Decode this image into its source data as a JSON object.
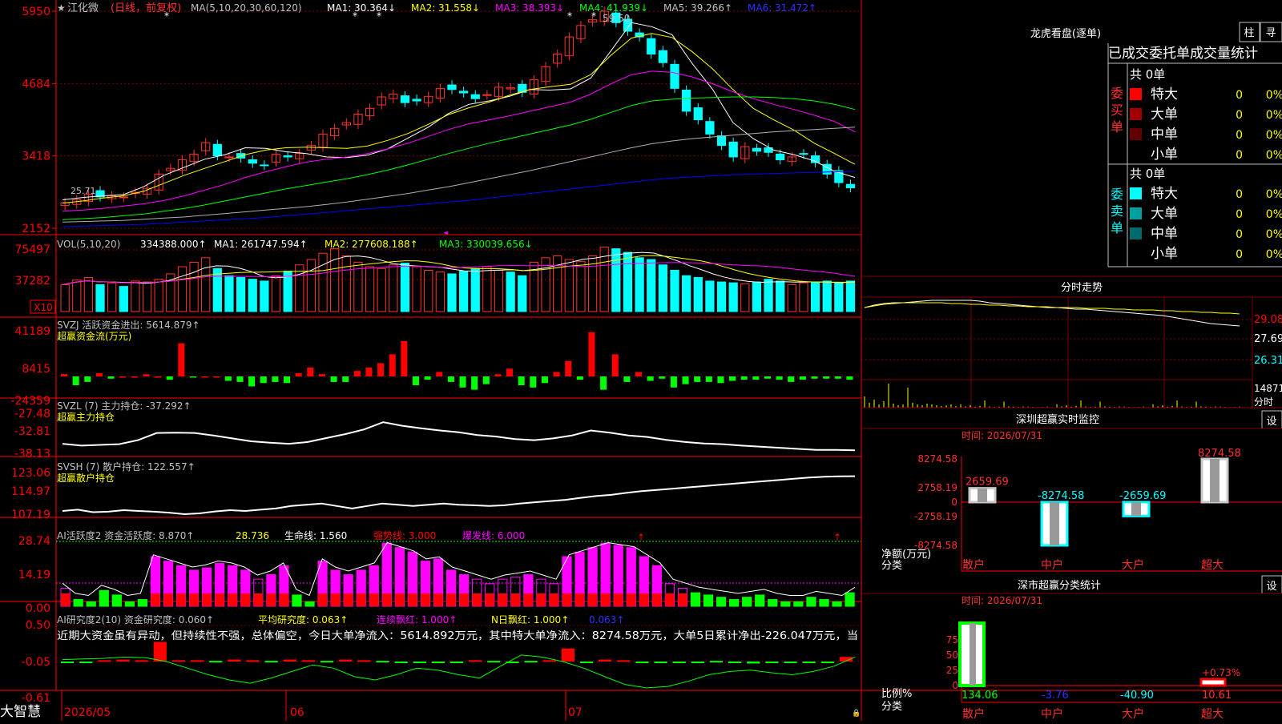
{
  "app": {
    "brand": "大智慧",
    "stock_name": "江化微",
    "period": "(日线，前复权)"
  },
  "colors": {
    "up": "#ff3232",
    "down": "#00ffff",
    "grid": "#800000",
    "axis": "#ff0000",
    "ma1": "#ffffff",
    "ma2": "#ffff00",
    "ma3": "#ff00ff",
    "ma4": "#00ff00",
    "ma5": "#b0b0b0",
    "ma6": "#0000ff"
  },
  "main": {
    "ma_header": "MA(5,10,20,30,60,120)",
    "ma_items": [
      {
        "label": "MA1: 30.364↓",
        "color": "#ffffff"
      },
      {
        "label": "MA2: 31.558↓",
        "color": "#ffff00"
      },
      {
        "label": "MA3: 38.393↓",
        "color": "#ff00ff"
      },
      {
        "label": "MA4: 41.939↓",
        "color": "#00ff00"
      },
      {
        "label": "MA5: 39.266↑",
        "color": "#c0c0c0"
      },
      {
        "label": "MA6: 31.472↑",
        "color": "#3030ff"
      }
    ],
    "y_ticks": [
      "5950",
      "4684",
      "3418",
      "2152"
    ],
    "high_label": "59.50",
    "low_label": "25.71"
  },
  "vol": {
    "header": "VOL(5,10,20)",
    "value": "334388.000↑",
    "ma1": "MA1: 261747.594↑",
    "ma2": "MA2: 277608.188↑",
    "ma3": "MA3: 330039.656↓",
    "y_ticks": [
      "75497",
      "37282"
    ],
    "unit": "X10"
  },
  "svzj": {
    "header": "SVZJ  活跃资金进出: 5614.879↑",
    "subtitle": "超赢资金流(万元)",
    "y_ticks": [
      "41189",
      "8415",
      "-24359"
    ]
  },
  "svzl": {
    "header": "SVZL (7) 主力持仓: -37.292↑",
    "subtitle": "超赢主力持仓",
    "y_ticks": [
      "-27.48",
      "-32.81",
      "-38.13"
    ]
  },
  "svsh": {
    "header": "SVSH (7) 散户持仓: 122.557↑",
    "subtitle": "超赢散户持仓",
    "y_ticks": [
      "123.06",
      "114.97",
      "107.19"
    ]
  },
  "ai1": {
    "header": "AI活跃度2 资金活跃度: 8.870↑",
    "v2": "28.736",
    "life": "生命线: 1.560",
    "strong": "强势线: 3.000",
    "burst": "爆发线: 6.000",
    "y_ticks": [
      "28.74",
      "14.19",
      "0.00"
    ]
  },
  "ai2": {
    "header": "AI研究度2(10) 资金研究度: 0.060↑",
    "avg": "平均研究度: 0.063↑",
    "lian": "连续飘红: 1.000↑",
    "nri": "N日飘红: 1.000↑",
    "last": "0.063↑",
    "y_ticks": [
      "0.50",
      "-0.05",
      "-0.61"
    ],
    "comment": "近期大资金虽有异动，但持续性不强，总体偏空，今日大单净流入：5614.892万元，其中特大单净流入：8274.58万元，大单5日累计净出-226.047万元，当"
  },
  "x_axis": {
    "labels": [
      "2026/05",
      "06",
      "07"
    ]
  },
  "right": {
    "lhb_title": "龙虎看盘(逐单)",
    "btn_zhu": "柱",
    "btn_zhu2": "寻",
    "stat_title": "已成交委托单成交量统计",
    "buy_group": "委买单",
    "sell_group": "委卖单",
    "buy_total": "共 0单",
    "sell_total": "共 0单",
    "buy_rows": [
      {
        "name": "特大",
        "count": "0",
        "pct": "0%",
        "color": "#ff0000"
      },
      {
        "name": "大单",
        "count": "0",
        "pct": "0%",
        "color": "#a00000"
      },
      {
        "name": "中单",
        "count": "0",
        "pct": "0%",
        "color": "#600000"
      },
      {
        "name": "小单",
        "count": "0",
        "pct": "0%",
        "color": ""
      }
    ],
    "sell_rows": [
      {
        "name": "特大",
        "count": "0",
        "pct": "0%",
        "color": "#00ffff"
      },
      {
        "name": "大单",
        "count": "0",
        "pct": "0%",
        "color": "#00a0a0"
      },
      {
        "name": "中单",
        "count": "0",
        "pct": "0%",
        "color": "#006a6a"
      },
      {
        "name": "小单",
        "count": "0",
        "pct": "0%",
        "color": ""
      }
    ],
    "intraday_title": "分时走势",
    "intraday_ticks": [
      "29.08",
      "27.69",
      "26.31"
    ],
    "intraday_vol": "14871",
    "intraday_vol_unit": "分时",
    "monitor_title": "深圳超赢实时监控",
    "monitor_btn": "设",
    "monitor_time": "时间: 2026/07/31",
    "monitor_y_ticks": [
      "8274.58",
      "2758.19",
      "0",
      "-2758.19",
      "-8274.58"
    ],
    "monitor_ylabel": "净额(万元)",
    "monitor_xlabel": "分类",
    "monitor_categories": [
      "散户",
      "中户",
      "大户",
      "超大"
    ],
    "monitor_values": [
      2659.69,
      -8274.58,
      -2659.69,
      8274.58
    ],
    "monitor_value_labels": [
      "2659.69",
      "-8274.58",
      "-2659.69",
      "8274.58"
    ],
    "class_title": "深市超赢分类统计",
    "class_btn": "设",
    "class_time": "时间: 2026/07/31",
    "class_y_ticks": [
      "75",
      "50",
      "25",
      "0"
    ],
    "class_ylabel": "比例%",
    "class_xlabel": "分类",
    "class_categories": [
      "散户",
      "中户",
      "大户",
      "超大"
    ],
    "class_values": [
      "134.06",
      "-3.76",
      "-40.90",
      "10.61"
    ],
    "class_extra": "+0.73%"
  },
  "chart_data": {
    "type": "candlestick",
    "title": "江化微",
    "x": [
      "2026/05",
      "06",
      "07"
    ],
    "ylim": [
      21.52,
      59.5
    ],
    "close": [
      26,
      26.5,
      27.5,
      27,
      27.2,
      27,
      27.8,
      28.5,
      31,
      32,
      33.5,
      34.5,
      36.5,
      34.2,
      34,
      33.8,
      32.9,
      32.5,
      34.5,
      34,
      34.6,
      36,
      38,
      39,
      40,
      41.5,
      42.5,
      44.5,
      45,
      43.5,
      43.8,
      44.6,
      46,
      45.8,
      45.2,
      44.2,
      44.9,
      46.2,
      46.1,
      45.3,
      47.5,
      49.8,
      52,
      55,
      57,
      58,
      59.5,
      57.5,
      56,
      55,
      52,
      50.5,
      46,
      42,
      40.5,
      38,
      36,
      34,
      35.8,
      35,
      34.8,
      33.5,
      34,
      34.5,
      33,
      31,
      29.5,
      28.6
    ],
    "series": [
      {
        "name": "MA1",
        "values": [
          26.5,
          26.9,
          27.2,
          27.4,
          28.8,
          30.8,
          32.2,
          33.6,
          34.4,
          35.6,
          35.5,
          34.9,
          34.6,
          34,
          33.9,
          34.3,
          35.4,
          37.3,
          39.2,
          41.6,
          43.2,
          43.8,
          44.6,
          45.8,
          45.7,
          45.9,
          47.8,
          52.6,
          57.5,
          56.8,
          55.4,
          50.3,
          45.8,
          40,
          37.2,
          35.2,
          34.4,
          33.3,
          31.5,
          30.4
        ]
      },
      {
        "name": "MA2",
        "values": [
          25.9,
          26.3,
          26.8,
          27.2,
          28,
          29.4,
          30.8,
          32,
          33.2,
          34.4,
          35.2,
          35.6,
          35.7,
          35.6,
          35.5,
          35.9,
          36.9,
          38.1,
          39.7,
          41.4,
          42.6,
          43.6,
          44.8,
          45.8,
          46.3,
          46.7,
          48.4,
          51.8,
          54.8,
          55.6,
          54.9,
          52.4,
          49.4,
          45.8,
          42.5,
          40.5,
          38.7,
          36.4,
          34.6,
          32.7
        ]
      },
      {
        "name": "MA3",
        "values": [
          24.5,
          24.7,
          25,
          25.4,
          25.8,
          26.4,
          27.2,
          28.2,
          29.2,
          30.4,
          31.4,
          32.3,
          33.1,
          33.6,
          34,
          34.6,
          35.4,
          36.4,
          37.6,
          38.8,
          39.8,
          40.5,
          41.2,
          42,
          42.8,
          43.6,
          45,
          46.8,
          48.4,
          49,
          48.8,
          48,
          46.8,
          45.4,
          44.2,
          43.2,
          42.3,
          41.3,
          40.2,
          38.4
        ]
      },
      {
        "name": "MA4",
        "values": [
          23,
          23.2,
          23.4,
          23.7,
          24,
          24.5,
          25,
          25.6,
          26.3,
          27,
          27.7,
          28.4,
          29,
          29.6,
          30.2,
          30.9,
          31.7,
          32.6,
          33.6,
          34.6,
          35.5,
          36.4,
          37.2,
          38,
          38.8,
          39.6,
          40.6,
          41.8,
          43,
          43.8,
          44.1,
          44.3,
          44.4,
          44.5,
          44.5,
          44.4,
          44.2,
          43.8,
          43.2,
          42.3
        ]
      },
      {
        "name": "MA5",
        "values": [
          22.6,
          22.7,
          22.8,
          22.9,
          23.1,
          23.3,
          23.5,
          23.8,
          24.1,
          24.4,
          24.7,
          25,
          25.3,
          25.7,
          26.1,
          26.6,
          27.1,
          27.6,
          28.2,
          28.8,
          29.5,
          30.2,
          30.9,
          31.6,
          32.4,
          33.2,
          34,
          34.8,
          35.6,
          36.3,
          36.8,
          37.2,
          37.5,
          37.8,
          38.1,
          38.4,
          38.6,
          38.8,
          39,
          39.2
        ]
      },
      {
        "name": "MA6",
        "values": [
          21.8,
          21.9,
          22,
          22.1,
          22.2,
          22.4,
          22.6,
          22.8,
          23,
          23.2,
          23.4,
          23.7,
          24,
          24.3,
          24.6,
          24.9,
          25.2,
          25.5,
          25.8,
          26.1,
          26.4,
          26.8,
          27.2,
          27.6,
          28,
          28.4,
          28.8,
          29.2,
          29.6,
          30,
          30.3,
          30.5,
          30.7,
          30.9,
          31,
          31.1,
          31.2,
          31.3,
          31.4,
          31.47
        ]
      }
    ],
    "volume": [
      30,
      35,
      38,
      30,
      32,
      28,
      34,
      33,
      36,
      42,
      50,
      55,
      60,
      48,
      40,
      38,
      36,
      34,
      40,
      45,
      52,
      58,
      65,
      70,
      62,
      55,
      50,
      48,
      52,
      54,
      50,
      46,
      44,
      42,
      45,
      48,
      50,
      46,
      44,
      40,
      55,
      60,
      62,
      58,
      56,
      62,
      72,
      70,
      66,
      60,
      58,
      52,
      46,
      40,
      38,
      34,
      33,
      32,
      31,
      33,
      36,
      34,
      30,
      32,
      33,
      34,
      32,
      34
    ],
    "svzj": [
      2,
      -8,
      -5,
      3,
      -2,
      0,
      0,
      2,
      0,
      -3,
      30,
      -1,
      0,
      0,
      -4,
      -5,
      -9,
      -6,
      -5,
      -6,
      3,
      8,
      2,
      -5,
      -5,
      5,
      8,
      12,
      20,
      32,
      -8,
      -3,
      4,
      -5,
      -10,
      -12,
      -7,
      2,
      7,
      -8,
      -10,
      -6,
      4,
      14,
      -3,
      40,
      -12,
      20,
      -5,
      4,
      -4,
      -2,
      -10,
      -7,
      -5,
      -5,
      -6,
      -4,
      -3,
      -3,
      -2,
      -3,
      -5,
      -3,
      -2,
      -2,
      -2,
      -3
    ],
    "svsh": [
      108.5,
      109,
      108,
      108.2,
      108.8,
      108.5,
      108.2,
      107.8,
      107.2,
      107.5,
      108.3,
      108.8,
      108.5,
      109,
      109.5,
      110.5,
      111,
      111.5,
      110.5,
      109.5,
      110.5,
      111.5,
      111,
      110.5,
      111,
      111.5,
      111,
      110.8,
      110.5,
      110.8,
      111.5,
      112,
      112.5,
      113,
      113.8,
      114.5,
      115,
      115.8,
      116.5,
      117,
      117.5,
      118,
      118.5,
      119,
      119.5,
      120,
      120.5,
      121,
      121.5,
      122,
      122.3,
      122.5,
      122.55
    ],
    "ai_active": [
      8,
      3,
      2,
      7,
      5,
      2,
      3,
      22,
      20,
      18,
      16,
      17,
      19,
      18,
      16,
      12,
      14,
      18,
      5,
      2,
      20,
      16,
      14,
      16,
      18,
      28,
      26,
      24,
      20,
      21,
      16,
      14,
      12,
      10,
      12,
      13,
      14,
      12,
      10,
      22,
      24,
      26,
      28,
      27,
      26,
      22,
      18,
      10,
      8,
      6,
      5,
      4,
      3,
      4,
      5,
      3,
      2,
      2,
      4,
      3,
      2,
      6
    ],
    "ai_research": [
      -0.05,
      -0.07,
      -0.03,
      -0.02,
      -0.03,
      0.25,
      -0.03,
      -0.03,
      -0.04,
      -0.02,
      -0.03,
      -0.04,
      -0.02,
      -0.03,
      -0.04,
      -0.02,
      -0.03,
      -0.04,
      -0.05,
      -0.06,
      -0.07,
      -0.05,
      -0.03,
      -0.04,
      -0.05,
      -0.04,
      -0.03,
      0.15,
      -0.05,
      -0.02,
      -0.03,
      -0.05,
      -0.06,
      -0.07,
      -0.05,
      -0.04,
      -0.06,
      -0.08,
      -0.07,
      -0.06,
      -0.05,
      -0.05,
      0.02
    ]
  }
}
